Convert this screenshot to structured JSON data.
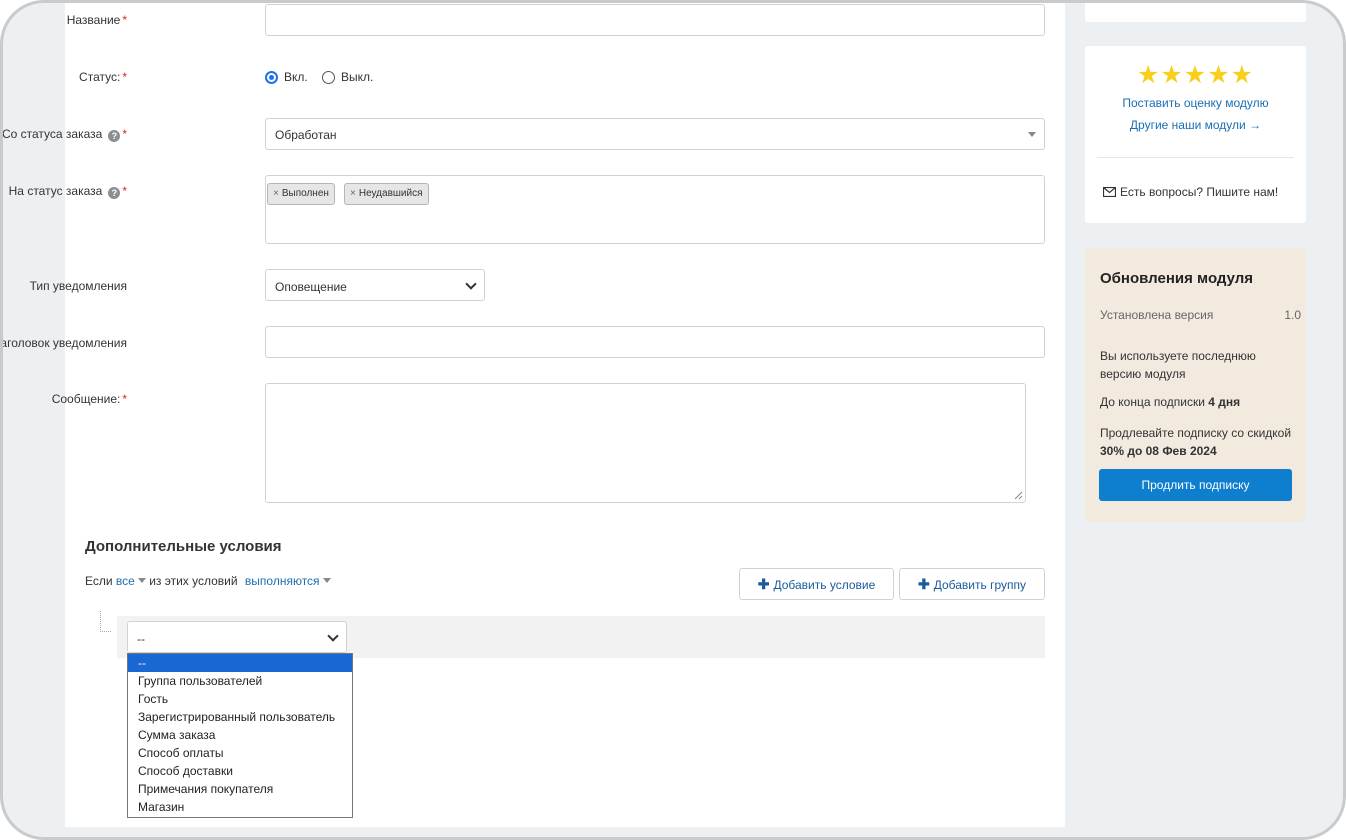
{
  "form": {
    "name_label": "Название",
    "status_label": "Статус:",
    "status_on": "Вкл.",
    "status_off": "Выкл.",
    "from_status_label": "Со статуса заказа",
    "from_status_value": "Обработан",
    "to_status_label": "На статус заказа",
    "to_status_tags": [
      "Выполнен",
      "Неудавшийся"
    ],
    "notify_type_label": "Тип уведомления",
    "notify_type_value": "Оповещение",
    "notify_title_label": "Заголовок уведомления",
    "message_label": "Сообщение:",
    "required_mark": "*",
    "help_icon_glyph": "?",
    "remove_glyph": "×"
  },
  "conditions": {
    "heading": "Дополнительные условия",
    "if_text": "Если",
    "all_link": "все",
    "of_these_text": "из этих условий",
    "fulfilled_link": "выполняются",
    "add_condition": "Добавить условие",
    "add_group": "Добавить группу",
    "select_value": "--",
    "options": [
      "--",
      "Группа пользователей",
      "Гость",
      "Зарегистрированный пользователь",
      "Сумма заказа",
      "Способ оплаты",
      "Способ доставки",
      "Примечания покупателя",
      "Магазин"
    ]
  },
  "sidebar": {
    "rate_link": "Поставить оценку модулю",
    "other_modules_link": "Другие наши модули →",
    "contact_text": "Есть вопросы? Пишите нам!",
    "updates_title": "Обновления модуля",
    "installed_version_label": "Установлена версия",
    "installed_version_value": "1.0",
    "latest_version_text": "Вы используете последнюю версию модуля",
    "subscription_end_text": "До конца подписки",
    "subscription_days": "4 дня",
    "renew_text": "Продлевайте подписку со скидкой",
    "discount_text": "30% до 08 Фев 2024",
    "renew_button": "Продлить подписку",
    "stars": "★★★★★",
    "rating": 5
  },
  "colors": {
    "accent": "#1a6fb5",
    "primary_button": "#0e7fcf",
    "updates_bg": "#f2eadf",
    "star": "#f8cf1c",
    "required": "#e02020"
  }
}
